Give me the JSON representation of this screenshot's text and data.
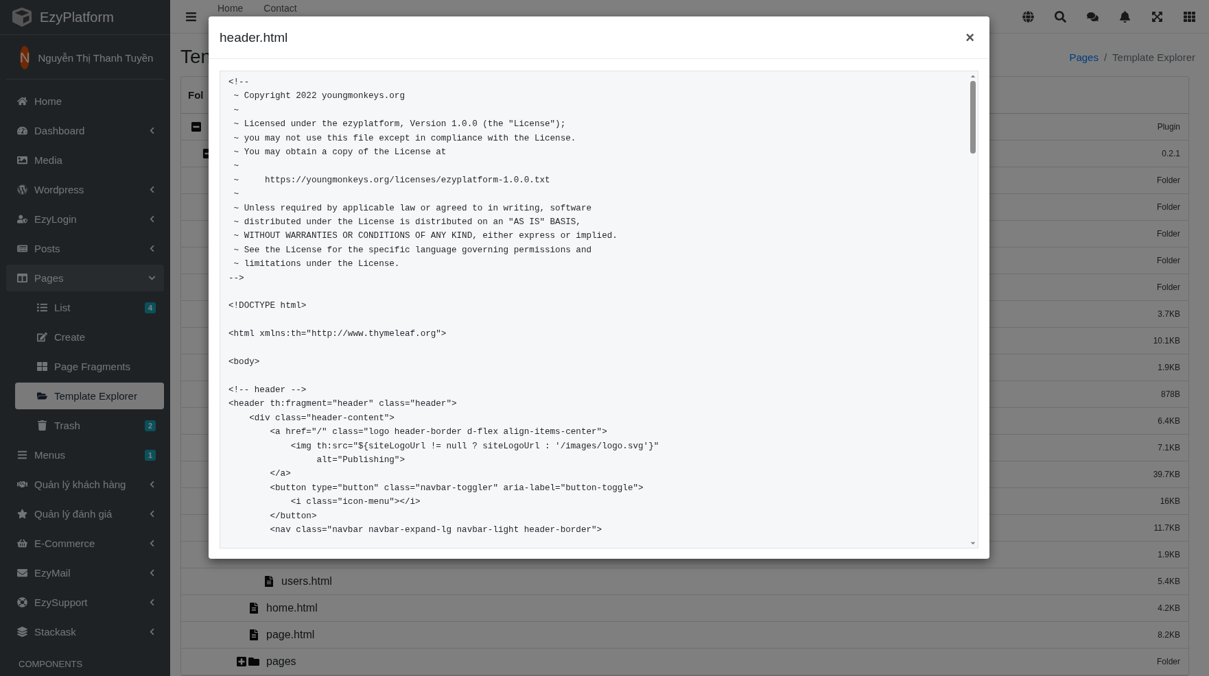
{
  "sidebar": {
    "brand": "EzyPlatform",
    "user": {
      "initial": "N",
      "name": "Nguyễn Thị Thanh Tuyền"
    },
    "items": [
      {
        "label": "Home"
      },
      {
        "label": "Dashboard",
        "expanded": false
      },
      {
        "label": "Media"
      },
      {
        "label": "Wordpress",
        "expanded": false
      },
      {
        "label": "EzyLogin",
        "expanded": false
      },
      {
        "label": "Posts",
        "expanded": false
      },
      {
        "label": "Pages",
        "expanded": true,
        "children": [
          {
            "label": "List",
            "badge": "4",
            "selected": false
          },
          {
            "label": "Create",
            "selected": false
          },
          {
            "label": "Page Fragments",
            "selected": false
          },
          {
            "label": "Template Explorer",
            "selected": true
          },
          {
            "label": "Trash",
            "badge": "2",
            "selected": false
          }
        ]
      },
      {
        "label": "Menus",
        "badge": "1"
      },
      {
        "label": "Quản lý khách hàng",
        "expanded": false
      },
      {
        "label": "Quản lý đánh giá",
        "expanded": false
      },
      {
        "label": "E-Commerce",
        "expanded": false
      },
      {
        "label": "EzyMail",
        "expanded": false
      },
      {
        "label": "EzySupport",
        "expanded": false
      },
      {
        "label": "Stackask",
        "expanded": false
      }
    ],
    "section_header": "COMPONENTS"
  },
  "topbar": {
    "links": [
      "Home",
      "Contact"
    ]
  },
  "content": {
    "title": "Ten",
    "breadcrumb_separator": "/",
    "breadcrumb": [
      {
        "label": "Pages",
        "link": true
      },
      {
        "label": "Template Explorer",
        "link": false
      }
    ],
    "card_header": "Fol",
    "tree": [
      {
        "column_2": "Plugin",
        "expanded": true,
        "children": [
          {
            "column_2": "0.2.1",
            "expanded": true,
            "children": [
              {
                "column_2": "Folder"
              },
              {
                "column_2": "Folder"
              },
              {
                "column_2": "Folder"
              },
              {
                "column_2": "Folder"
              },
              {
                "column_2": "Folder",
                "children": [
                  {
                    "column_2": "3.7KB"
                  },
                  {
                    "column_2": "10.1KB"
                  },
                  {
                    "column_2": "1.9KB"
                  },
                  {
                    "column_2": "878B"
                  },
                  {
                    "column_2": "6.4KB"
                  },
                  {
                    "column_2": "7.1KB"
                  },
                  {
                    "column_2": "39.7KB"
                  },
                  {
                    "column_2": "16KB"
                  },
                  {
                    "column_2": "11.7KB"
                  },
                  {
                    "column_2": "1.9KB"
                  },
                  {
                    "name": "users.html",
                    "kind": "file",
                    "column_2": "5.4KB"
                  }
                ]
              },
              {
                "name": "home.html",
                "kind": "file",
                "column_2": "4.2KB"
              },
              {
                "name": "page.html",
                "kind": "file",
                "column_2": "8.2KB"
              },
              {
                "name": "pages",
                "kind": "folder",
                "expanded": false,
                "column_2": "Folder"
              }
            ]
          }
        ]
      }
    ]
  },
  "modal": {
    "title": "header.html",
    "close": "×",
    "code_blocks": [
      [
        "<!--",
        " ~ Copyright 2022 youngmonkeys.org",
        " ~",
        " ~ Licensed under the ezyplatform, Version 1.0.0 (the \"License\");",
        " ~ you may not use this file except in compliance with the License.",
        " ~ You may obtain a copy of the License at",
        " ~",
        " ~     https://youngmonkeys.org/licenses/ezyplatform-1.0.0.txt",
        " ~",
        " ~ Unless required by applicable law or agreed to in writing, software",
        " ~ distributed under the License is distributed on an \"AS IS\" BASIS,",
        " ~ WITHOUT WARRANTIES OR CONDITIONS OF ANY KIND, either express or implied.",
        " ~ See the License for the specific language governing permissions and",
        " ~ limitations under the License.",
        "-->"
      ],
      [
        "<!DOCTYPE html>"
      ],
      [
        "<html xmlns:th=\"http://www.thymeleaf.org\">"
      ],
      [
        "<body>"
      ],
      [
        "<!-- header -->",
        "<header th:fragment=\"header\" class=\"header\">",
        "    <div class=\"header-content\">",
        "        <a href=\"/\" class=\"logo header-border d-flex align-items-center\">",
        "            <img th:src=\"${siteLogoUrl != null ? siteLogoUrl : '/images/logo.svg'}\"",
        "                 alt=\"Publishing\">",
        "        </a>",
        "        <button type=\"button\" class=\"navbar-toggler\" aria-label=\"button-toggle\">",
        "            <i class=\"icon-menu\"></i>",
        "        </button>",
        "        <nav class=\"navbar navbar-expand-lg navbar-light header-border\">"
      ]
    ]
  }
}
